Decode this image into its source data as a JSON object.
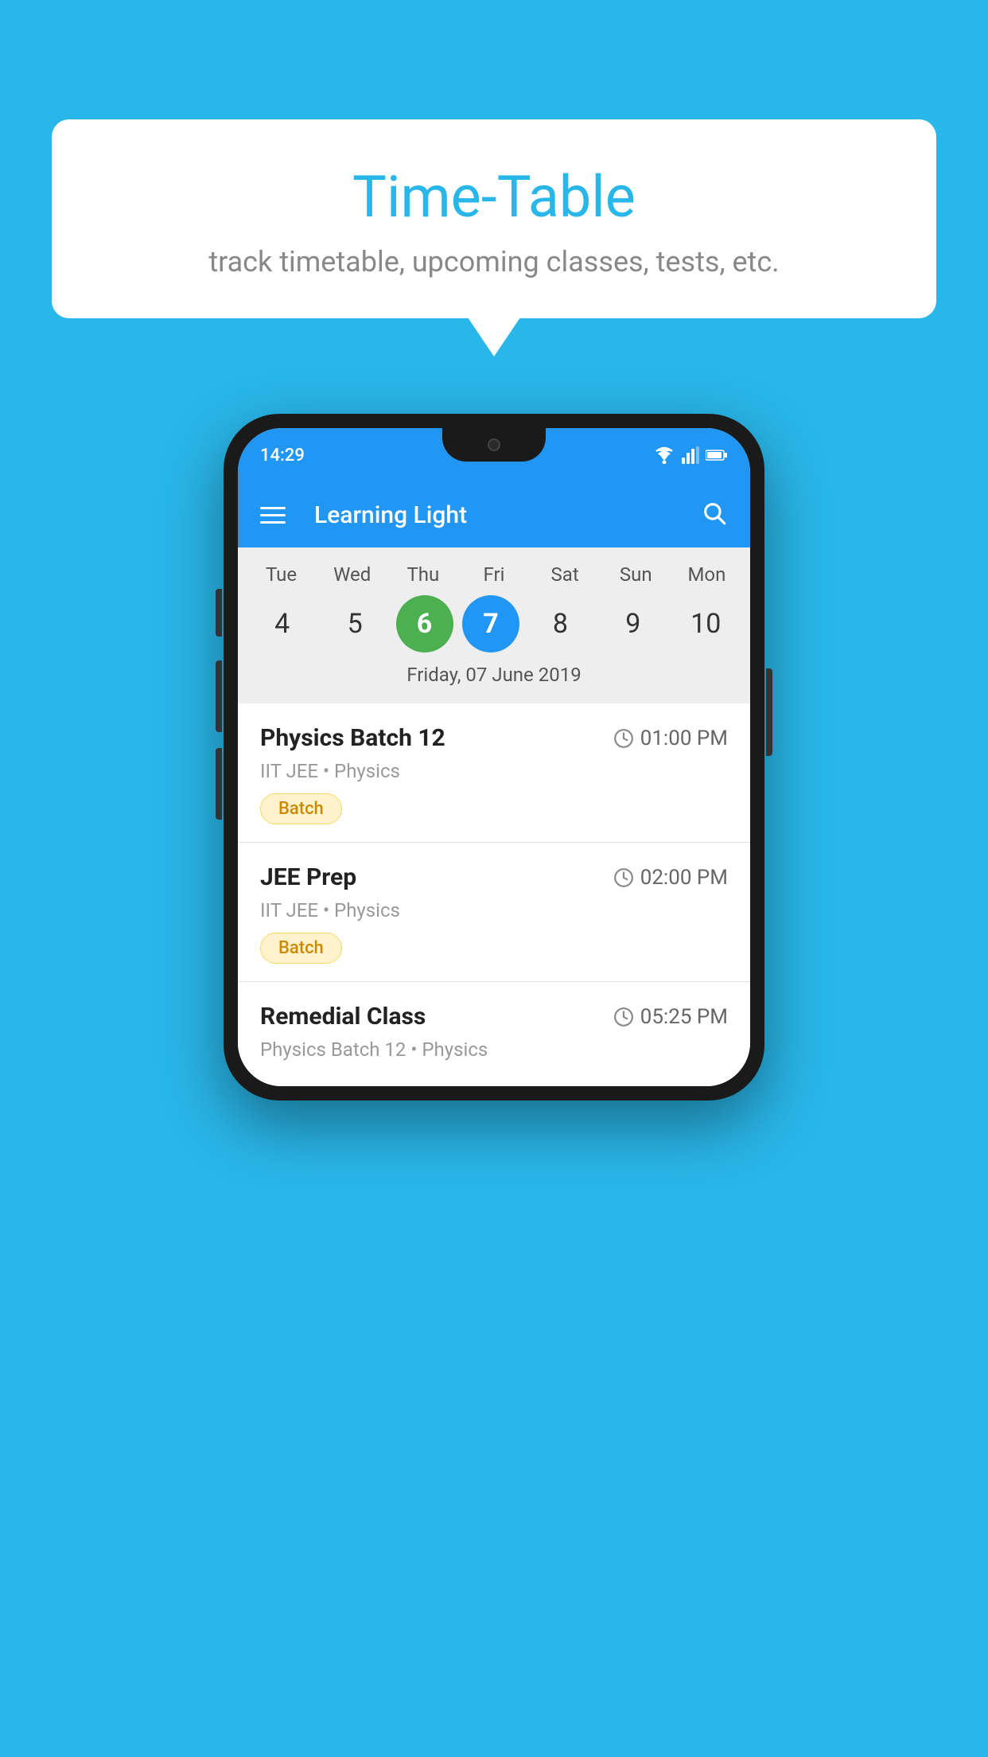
{
  "page": {
    "background_color": "#29B6E8"
  },
  "speech_bubble": {
    "title": "Time-Table",
    "subtitle": "track timetable, upcoming classes, tests, etc."
  },
  "phone": {
    "status_bar": {
      "time": "14:29"
    },
    "app_bar": {
      "title": "Learning Light"
    },
    "calendar": {
      "selected_date_label": "Friday, 07 June 2019",
      "days": [
        {
          "header": "Tue",
          "number": "4",
          "state": "normal"
        },
        {
          "header": "Wed",
          "number": "5",
          "state": "normal"
        },
        {
          "header": "Thu",
          "number": "6",
          "state": "today"
        },
        {
          "header": "Fri",
          "number": "7",
          "state": "selected"
        },
        {
          "header": "Sat",
          "number": "8",
          "state": "normal"
        },
        {
          "header": "Sun",
          "number": "9",
          "state": "normal"
        },
        {
          "header": "Mon",
          "number": "10",
          "state": "normal"
        }
      ]
    },
    "schedule": [
      {
        "title": "Physics Batch 12",
        "time": "01:00 PM",
        "subtitle": "IIT JEE • Physics",
        "badge": "Batch"
      },
      {
        "title": "JEE Prep",
        "time": "02:00 PM",
        "subtitle": "IIT JEE • Physics",
        "badge": "Batch"
      },
      {
        "title": "Remedial Class",
        "time": "05:25 PM",
        "subtitle": "Physics Batch 12 • Physics",
        "badge": null
      }
    ]
  },
  "icons": {
    "hamburger": "☰",
    "search": "🔍",
    "clock": "🕐"
  }
}
